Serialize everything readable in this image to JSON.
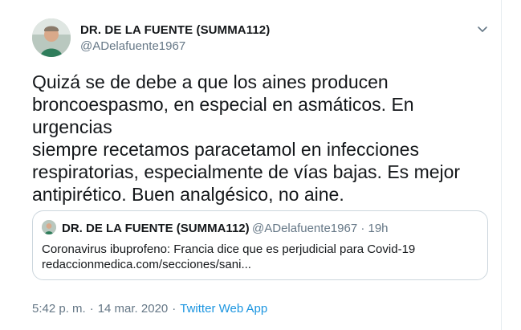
{
  "author": {
    "name": "DR. DE LA FUENTE (SUMMA112)",
    "handle": "@ADelafuente1967"
  },
  "tweet": {
    "lines": [
      "Quizá se de debe a que los aines producen",
      "broncoespasmo, en especial en asmáticos. En urgencias",
      "siempre recetamos paracetamol en infecciones",
      "respiratorias, especialmente de vías bajas. Es mejor",
      "antipirético. Buen analgésico, no aine."
    ]
  },
  "quote": {
    "name": "DR. DE LA FUENTE (SUMMA112)",
    "handle_time": "@ADelafuente1967 · 19h",
    "line1": "Coronavirus ibuprofeno: Francia dice que es perjudicial para Covid-19",
    "line2": "redaccionmedica.com/secciones/sani..."
  },
  "meta": {
    "time": "5:42 p. m.",
    "date": "14 mar. 2020",
    "dot": "·",
    "source": "Twitter Web App"
  },
  "icons": {
    "caret": "chevron-down-icon"
  },
  "colors": {
    "text": "#14171a",
    "secondary": "#657786",
    "link": "#1b95e0",
    "border": "#ccd6dd"
  }
}
